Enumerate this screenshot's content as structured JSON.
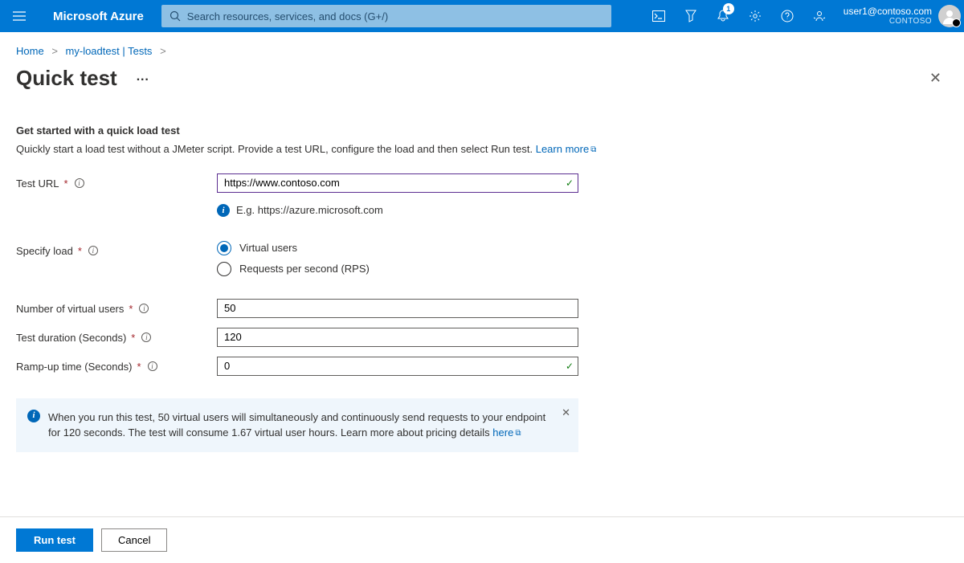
{
  "header": {
    "brand": "Microsoft Azure",
    "search_placeholder": "Search resources, services, and docs (G+/)",
    "notification_count": "1",
    "user_email": "user1@contoso.com",
    "tenant": "CONTOSO"
  },
  "crumbs": {
    "home": "Home",
    "resource": "my-loadtest | Tests"
  },
  "page": {
    "title": "Quick test",
    "section_heading": "Get started with a quick load test",
    "section_desc_main": "Quickly start a load test without a JMeter script. Provide a test URL, configure the load and then select Run test. ",
    "learn_more": "Learn more"
  },
  "form": {
    "test_url_label": "Test URL",
    "test_url_value": "https://www.contoso.com",
    "test_url_hint": "E.g. https://azure.microsoft.com",
    "specify_load_label": "Specify load",
    "load_opts": {
      "virtual_users": "Virtual users",
      "rps": "Requests per second (RPS)"
    },
    "num_users_label": "Number of virtual users",
    "num_users_value": "50",
    "duration_label": "Test duration (Seconds)",
    "duration_value": "120",
    "rampup_label": "Ramp-up time (Seconds)",
    "rampup_value": "0"
  },
  "callout": {
    "text_1": "When you run this test, 50 virtual users will simultaneously and continuously send requests to your endpoint for 120 seconds. The test will consume 1.67 virtual user hours. Learn more about pricing details ",
    "here": "here"
  },
  "footer": {
    "run": "Run test",
    "cancel": "Cancel"
  }
}
